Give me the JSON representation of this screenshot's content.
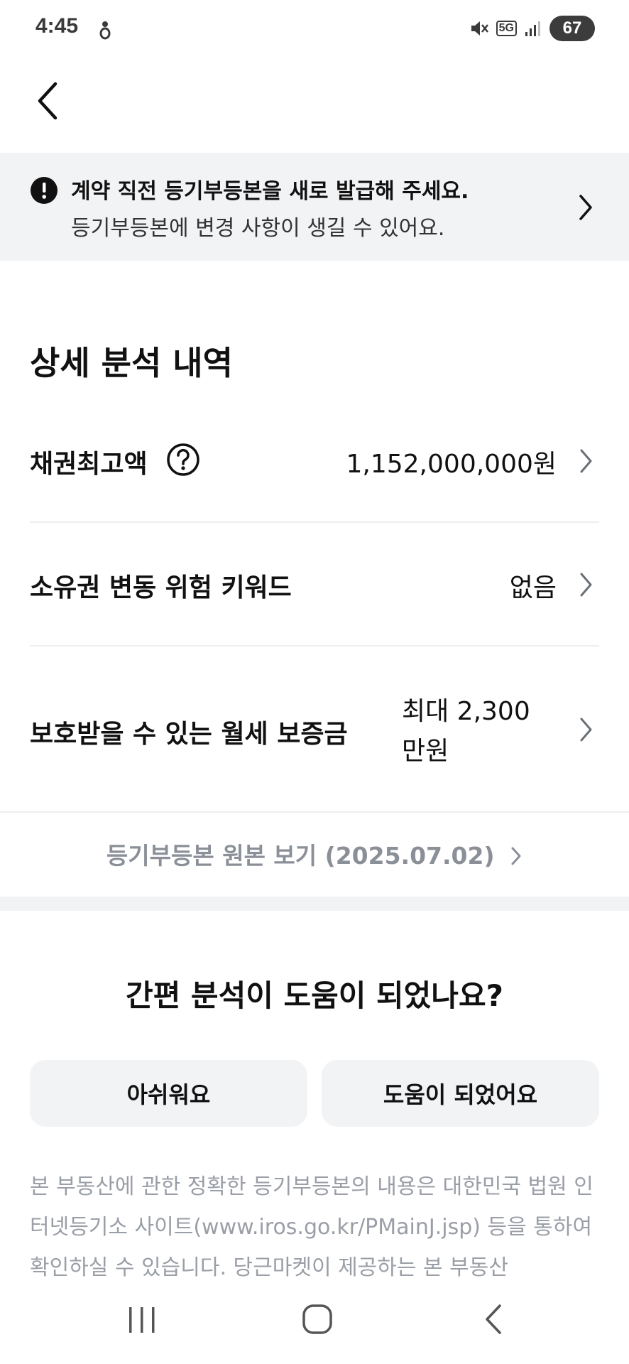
{
  "status_bar": {
    "time": "4:45",
    "network": "5G",
    "battery": "67"
  },
  "banner": {
    "title": "계약 직전 등기부등본을 새로 발급해 주세요.",
    "subtitle": "등기부등본에 변경 사항이 생길 수 있어요."
  },
  "section": {
    "title": "상세 분석 내역",
    "rows": [
      {
        "label": "채권최고액",
        "value": "1,152,000,000원"
      },
      {
        "label": "소유권 변동 위험 키워드",
        "value": "없음"
      },
      {
        "label": "보호받을 수 있는 월세 보증금",
        "value_line1": "최대 2,300",
        "value_line2": "만원"
      }
    ],
    "original_link": "등기부등본 원본 보기 (2025.07.02)"
  },
  "feedback": {
    "question": "간편 분석이 도움이 되었나요?",
    "negative_label": "아쉬워요",
    "positive_label": "도움이 되었어요"
  },
  "disclaimer": "본 부동산에 관한 정확한 등기부등본의 내용은 대한민국 법원 인터넷등기소 사이트(www.iros.go.kr/PMainJ.jsp) 등을 통하여 확인하실 수 있습니다. 당근마켓이 제공하는 본 부동산",
  "icons": {
    "back": "back-arrow-icon",
    "alert": "alert-circle-icon",
    "help": "help-circle-icon",
    "chevron": "chevron-right-icon"
  }
}
